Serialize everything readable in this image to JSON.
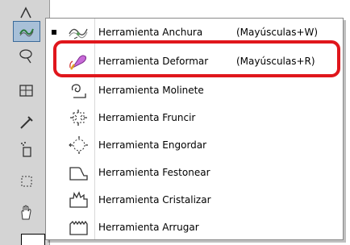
{
  "toolbar": {
    "tools": [
      {
        "icon": "brush-tool-icon"
      },
      {
        "icon": "liquify-tool-icon"
      },
      {
        "icon": "lasso-tool-icon"
      },
      {
        "icon": "frame-tool-icon"
      },
      {
        "icon": "eyedropper-icon"
      },
      {
        "icon": "spray-symbol-icon"
      },
      {
        "icon": "artboard-icon"
      },
      {
        "icon": "hand-icon"
      }
    ]
  },
  "menu": {
    "items": [
      {
        "label": "Herramienta Anchura",
        "shortcut": "(Mayúsculas+W)",
        "icon": "width-tool-icon",
        "selected": true
      },
      {
        "label": "Herramienta Deformar",
        "shortcut": "(Mayúsculas+R)",
        "icon": "warp-tool-icon",
        "selected": false
      },
      {
        "label": "Herramienta Molinete",
        "shortcut": "",
        "icon": "twirl-tool-icon",
        "selected": false
      },
      {
        "label": "Herramienta Fruncir",
        "shortcut": "",
        "icon": "pucker-tool-icon",
        "selected": false
      },
      {
        "label": "Herramienta Engordar",
        "shortcut": "",
        "icon": "bloat-tool-icon",
        "selected": false
      },
      {
        "label": "Herramienta Festonear",
        "shortcut": "",
        "icon": "scallop-tool-icon",
        "selected": false
      },
      {
        "label": "Herramienta Cristalizar",
        "shortcut": "",
        "icon": "crystallize-tool-icon",
        "selected": false
      },
      {
        "label": "Herramienta Arrugar",
        "shortcut": "",
        "icon": "wrinkle-tool-icon",
        "selected": false
      }
    ]
  },
  "colors": {
    "highlight": "#e0161c",
    "toolbar_bg": "#d4d4d4",
    "active_tool": "#a8c0d8"
  }
}
